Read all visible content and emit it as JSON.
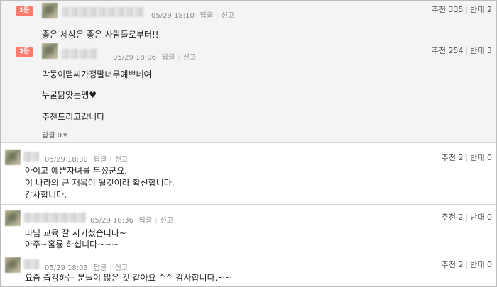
{
  "comments": [
    {
      "rank": "1등",
      "date": "05/29 18:10",
      "reply_label": "답글",
      "report_label": "신고",
      "like_label": "추천",
      "likes": "335",
      "dislike_label": "반대",
      "dislikes": "2",
      "lines": [
        "좋은 세상은 좋은 사람들로부터!!"
      ]
    },
    {
      "rank": "2등",
      "date": "05/29 18:06",
      "reply_label": "답글",
      "report_label": "신고",
      "like_label": "추천",
      "likes": "254",
      "dislike_label": "반대",
      "dislikes": "3",
      "lines": [
        "막둥이맴씨가정말너무예쁘네여",
        "누굴닮앗는뎅♥",
        "추천드리고갑니다"
      ],
      "reply_count": "답글 0"
    },
    {
      "date": "05/29 18:30",
      "reply_label": "답글",
      "report_label": "신고",
      "like_label": "추천",
      "likes": "2",
      "dislike_label": "반대",
      "dislikes": "0",
      "lines": [
        "아이고 예쁜자녀를 두셨군요.",
        "이 나라의 큰 재목이 될것이라 확신합니다.",
        "감사합니다."
      ]
    },
    {
      "date": "05/29 18:36",
      "reply_label": "답글",
      "report_label": "신고",
      "like_label": "추천",
      "likes": "2",
      "dislike_label": "반대",
      "dislikes": "0",
      "lines": [
        "따님 교육 잘 시키셨습니다~",
        "아주~훌륭 하십니다~~~"
      ]
    },
    {
      "date": "05/29 18:03",
      "reply_label": "답글",
      "report_label": "신고",
      "like_label": "추천",
      "likes": "2",
      "dislike_label": "반대",
      "dislikes": "0",
      "lines": [
        "요즘 즙강하는 분들이 많은 것 같아요 ^^ 감사합니다.~~"
      ]
    }
  ],
  "colors": {
    "rank_badge": "#ff7a6b",
    "best_background": "#f4f4f4",
    "separator": "#d6d6d6",
    "frame_border": "#bdbdbd"
  }
}
